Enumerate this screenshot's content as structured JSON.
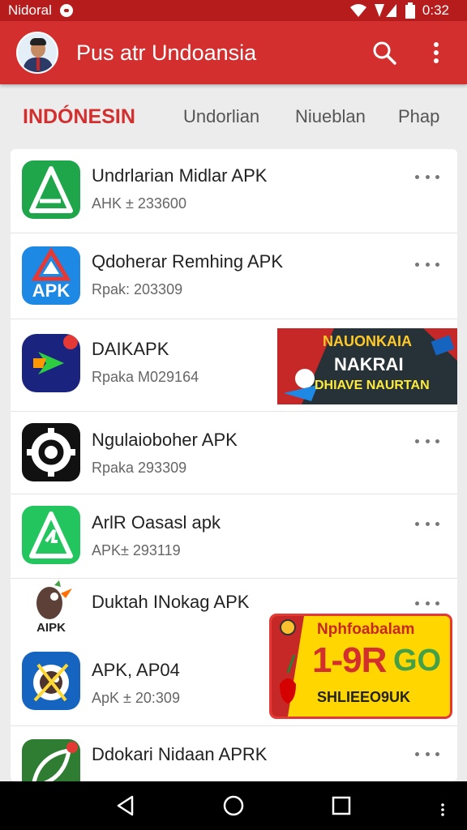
{
  "status_bar": {
    "carrier": "Nidoral",
    "time": "0:32"
  },
  "app_bar": {
    "title": "Pus atr Undoansia"
  },
  "tabs": [
    {
      "label": "INDÓNESIN",
      "active": true
    },
    {
      "label": "Undorlian",
      "active": false
    },
    {
      "label": "Niueblan",
      "active": false
    },
    {
      "label": "Phap",
      "active": false
    }
  ],
  "apps": [
    {
      "name": "Undrlarian Midlar APK",
      "meta": "AHK ± 233600",
      "icon": "green-triangle-logo-icon"
    },
    {
      "name": "Qdoherar Remhing APK",
      "meta": "Rpak: 203309",
      "icon": "apk-badge-icon",
      "icon_text": "APK"
    },
    {
      "name": "DAIKAPK",
      "meta": "Rpaka M029164",
      "icon": "play-arrow-logo-icon"
    },
    {
      "name": "Ngulaioboher APK",
      "meta": "Rpaka 293309",
      "icon": "gear-logo-icon"
    },
    {
      "name": "ArlR Oasasl apk",
      "meta": "APK± 293119",
      "icon": "green-triangle-logo-icon"
    },
    {
      "name": "Duktah INokag APK",
      "meta": "",
      "icon": "bird-mascot-icon",
      "icon_text": "AIPK"
    },
    {
      "name": "APK, AP04",
      "meta": "ApK ± 20:309",
      "icon": "ninja-mascot-icon"
    },
    {
      "name": "Ddokari Nidaan APRK",
      "meta": "",
      "icon": "green-leaf-logo-icon"
    }
  ],
  "banner_top": {
    "line1": "NAUONKAIA",
    "line2": "NAKRAI",
    "line3": "DHIAVE NAURTAN"
  },
  "banner_bottom": {
    "line1": "Nphfoabalam",
    "big": "1-9R",
    "go": "GO",
    "line3": "SHLIEEO9UK"
  },
  "colors": {
    "primary": "#d32f2f",
    "status": "#b71c1c",
    "green": "#1db954"
  }
}
